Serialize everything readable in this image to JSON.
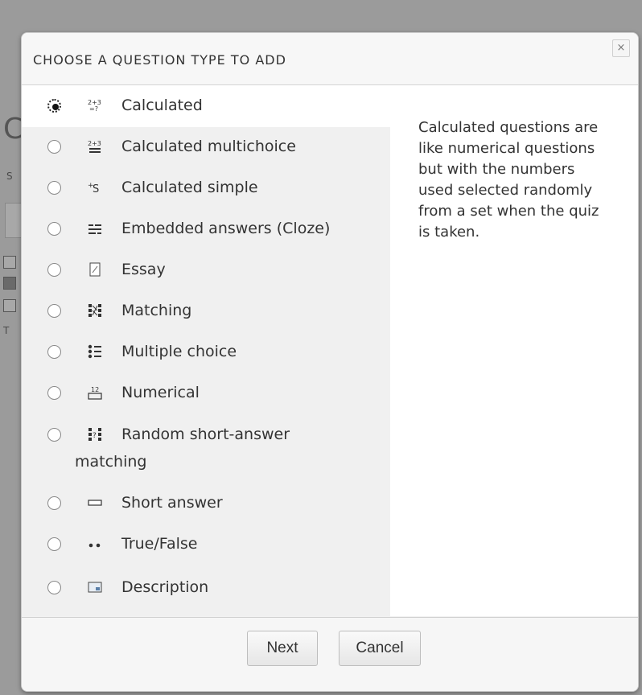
{
  "dialog": {
    "title": "CHOOSE A QUESTION TYPE TO ADD",
    "close_label": "×",
    "description": "Calculated questions are like numerical questions but with the numbers used selected randomly from a set when the quiz is taken.",
    "selected_type": "Calculated"
  },
  "question_types": [
    {
      "label": "Calculated",
      "icon": "calculated-icon",
      "selected": true
    },
    {
      "label": "Calculated multichoice",
      "icon": "calculated-multichoice-icon",
      "selected": false
    },
    {
      "label": "Calculated simple",
      "icon": "calculated-simple-icon",
      "selected": false
    },
    {
      "label": "Embedded answers (Cloze)",
      "icon": "cloze-icon",
      "selected": false
    },
    {
      "label": "Essay",
      "icon": "essay-icon",
      "selected": false
    },
    {
      "label": "Matching",
      "icon": "matching-icon",
      "selected": false
    },
    {
      "label": "Multiple choice",
      "icon": "multiple-choice-icon",
      "selected": false
    },
    {
      "label": "Numerical",
      "icon": "numerical-icon",
      "selected": false
    },
    {
      "label": "Random short-answer",
      "label_line2": "matching",
      "icon": "random-short-answer-icon",
      "selected": false
    },
    {
      "label": "Short answer",
      "icon": "short-answer-icon",
      "selected": false
    },
    {
      "label": "True/False",
      "icon": "true-false-icon",
      "selected": false
    }
  ],
  "other_types": [
    {
      "label": "Description",
      "icon": "description-icon",
      "selected": false
    }
  ],
  "footer": {
    "next_label": "Next",
    "cancel_label": "Cancel"
  },
  "background_fragments": {
    "letter_c": "C",
    "letter_s": "S",
    "letter_t": "T"
  }
}
